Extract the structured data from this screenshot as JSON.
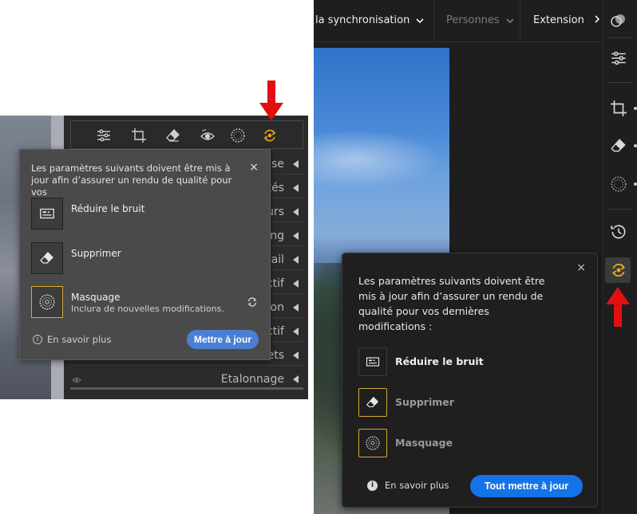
{
  "left": {
    "popup": {
      "message": "Les paramètres suivants doivent être mis à jour afin d’assurer un rendu de qualité pour vos",
      "close": "×",
      "items": [
        {
          "name": "Réduire le bruit",
          "sub": ""
        },
        {
          "name": "Supprimer",
          "sub": ""
        },
        {
          "name": "Masquage",
          "sub": "Inclura de nouvelles modifications."
        }
      ],
      "learn_more": "En savoir plus",
      "update_button": "Mettre à jour"
    },
    "panel_sections": [
      "se",
      "tés",
      "urs",
      "ng",
      "ail",
      "ctif",
      "on",
      "ctif",
      "ets",
      "Etalonnage"
    ],
    "tools": [
      "adjust-sliders-icon",
      "crop-icon",
      "eraser-icon",
      "redeye-icon",
      "masking-icon",
      "update-sync-icon"
    ]
  },
  "right": {
    "topbar": {
      "sync": "la synchronisation",
      "people": "Personnes",
      "extension": "Extension"
    },
    "sidebar_tools": [
      "edit-icon",
      "adjust-sliders-icon",
      "crop-icon",
      "eraser-icon",
      "masking-icon",
      "history-icon",
      "update-sync-icon"
    ],
    "popup": {
      "message": "Les paramètres suivants doivent être mis à jour afin d’assurer un rendu de qualité pour vos dernières modifications :",
      "close": "×",
      "items": [
        {
          "name": "Réduire le bruit"
        },
        {
          "name": "Supprimer"
        },
        {
          "name": "Masquage"
        }
      ],
      "learn_more": "En savoir plus",
      "update_button": "Tout mettre à jour"
    }
  },
  "colors": {
    "accent_blue_left": "#4a7fd3",
    "accent_blue_right": "#1473e6",
    "selection_gold": "#d6a936",
    "annotation_red": "#e01010"
  }
}
